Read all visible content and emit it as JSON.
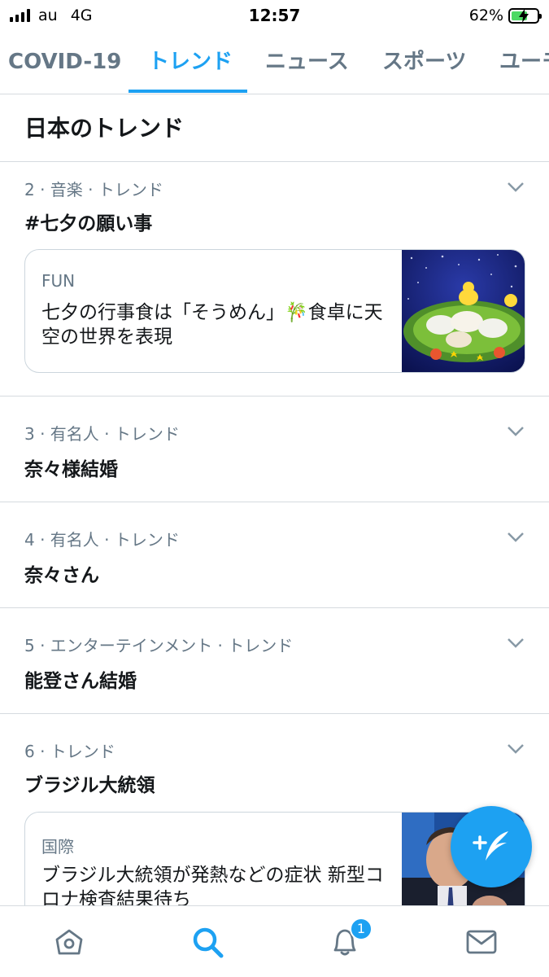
{
  "status_bar": {
    "carrier": "au",
    "network": "4G",
    "time": "12:57",
    "battery_percent": "62%",
    "battery_level": 0.62
  },
  "tabs": [
    {
      "label": "COVID-19",
      "active": false
    },
    {
      "label": "トレンド",
      "active": true
    },
    {
      "label": "ニュース",
      "active": false
    },
    {
      "label": "スポーツ",
      "active": false
    },
    {
      "label": "ユーモ",
      "active": false
    }
  ],
  "section_title": "日本のトレンド",
  "trends": [
    {
      "meta": "2 · 音楽 · トレンド",
      "name": "#七夕の願い事",
      "card": {
        "category": "FUN",
        "text": "七夕の行事食は「そうめん」🎋食卓に天空の世界を表現",
        "image": "somen-tanabata-photo"
      }
    },
    {
      "meta": "3 · 有名人 · トレンド",
      "name": "奈々様結婚"
    },
    {
      "meta": "4 · 有名人 · トレンド",
      "name": "奈々さん"
    },
    {
      "meta": "5 · エンターテインメント · トレンド",
      "name": "能登さん結婚"
    },
    {
      "meta": "6 · トレンド",
      "name": "ブラジル大統領",
      "card": {
        "category": "国際",
        "text": "ブラジル大統領が発熱などの症状 新型コロナ検査結果待ち",
        "image": "president-photo"
      }
    }
  ],
  "fab": {
    "icon": "compose-tweet-icon"
  },
  "bottom_nav": {
    "items": [
      {
        "icon": "home-icon",
        "active": false
      },
      {
        "icon": "search-icon",
        "active": true
      },
      {
        "icon": "notifications-bell-icon",
        "active": false
      },
      {
        "icon": "messages-envelope-icon",
        "active": false
      }
    ],
    "notification_badge": "1"
  },
  "colors": {
    "accent": "#1da1f2",
    "text_primary": "#14171a",
    "text_secondary": "#657786",
    "divider": "#d6dbdf"
  }
}
